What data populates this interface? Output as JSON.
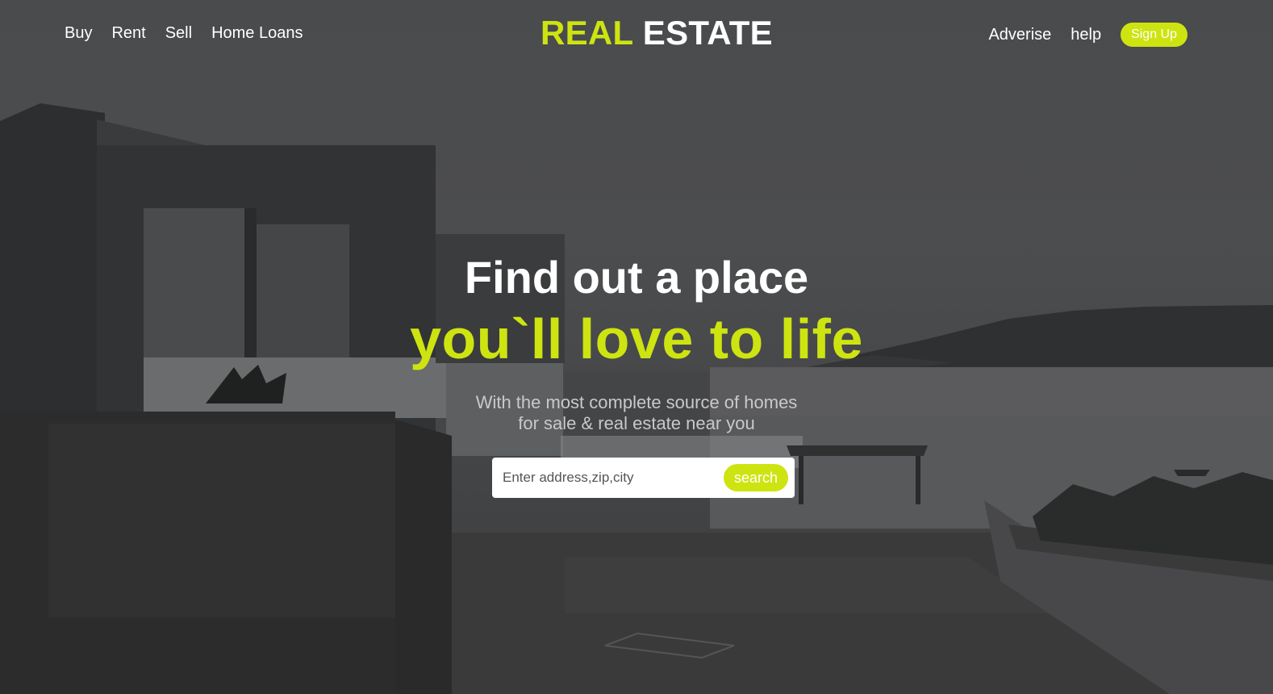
{
  "nav": {
    "left_items": [
      {
        "label": "Buy"
      },
      {
        "label": "Rent"
      },
      {
        "label": "Sell"
      },
      {
        "label": "Home Loans"
      }
    ],
    "logo": {
      "accent": "REAL",
      "plain": "ESTATE"
    },
    "right_items": [
      {
        "label": "Adverise"
      },
      {
        "label": "help"
      }
    ],
    "signup_label": "Sign Up"
  },
  "hero": {
    "title": "Find out a place",
    "subtitle": "you`ll love to life",
    "description_line1": "With the most complete source of homes",
    "description_line2": "for sale & real estate near you"
  },
  "search": {
    "placeholder": "Enter address,zip,city",
    "value": "",
    "button_label": "search"
  },
  "colors": {
    "accent": "#cde411",
    "overlay": "#3c3d3f"
  },
  "background_image": "dark-tinted-seaside-villa-photo"
}
